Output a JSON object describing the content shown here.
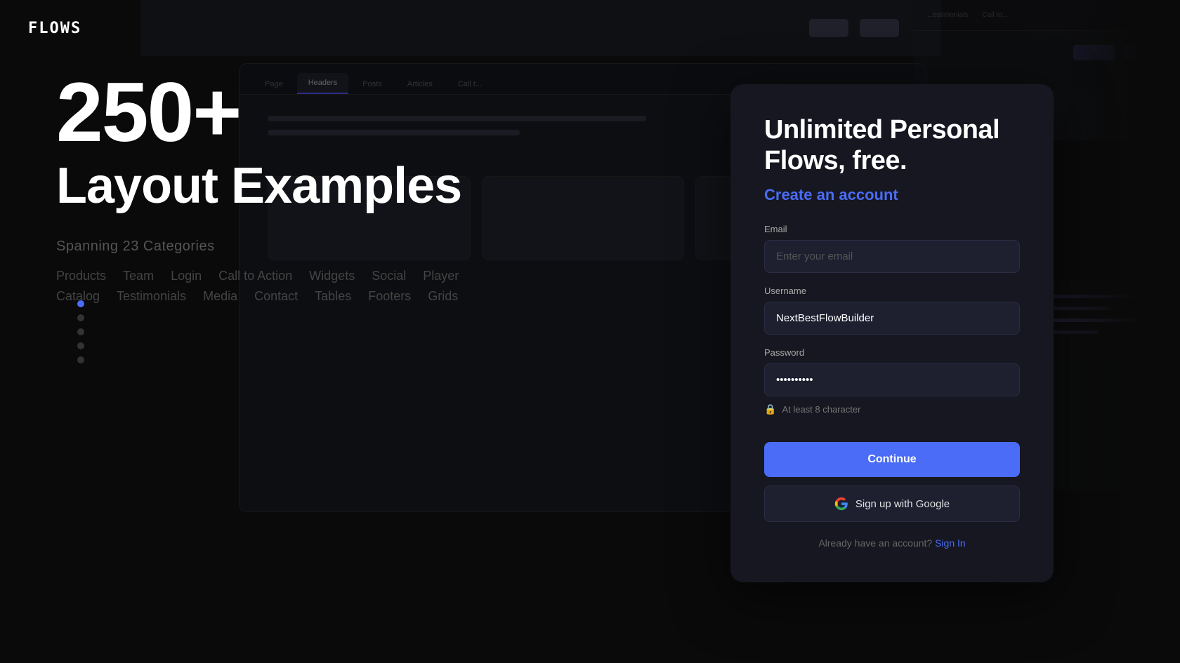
{
  "logo": {
    "text": "FLOWS"
  },
  "hero": {
    "number": "250+",
    "title": "Layout Examples",
    "categories_label": "Spanning 23 Categories",
    "tags": [
      "Products",
      "Team",
      "Login",
      "Call to Action",
      "Widgets",
      "Social",
      "Player",
      "Catalog",
      "Testimonials",
      "Media",
      "Contact",
      "Tables",
      "Footers",
      "Grids"
    ]
  },
  "nav_dots": [
    {
      "active": true
    },
    {
      "active": false
    },
    {
      "active": false
    },
    {
      "active": false
    },
    {
      "active": false
    }
  ],
  "browser_tabs": [
    "Page",
    "Headers",
    "Posts",
    "Articles",
    "Call t..."
  ],
  "signup": {
    "headline": "Unlimited Personal Flows, free.",
    "subheading": "Create an account",
    "email_label": "Email",
    "email_placeholder": "Enter your email",
    "username_label": "Username",
    "username_value": "NextBestFlowBuilder",
    "password_label": "Password",
    "password_value": "••••••••••",
    "password_hint": "At least 8 character",
    "continue_label": "Continue",
    "google_label": "Sign up with Google",
    "signin_text": "Already have an account?",
    "signin_link": "Sign In"
  },
  "colors": {
    "accent": "#4a6cf7",
    "bg_card": "#161720",
    "bg_input": "#1e2030"
  }
}
